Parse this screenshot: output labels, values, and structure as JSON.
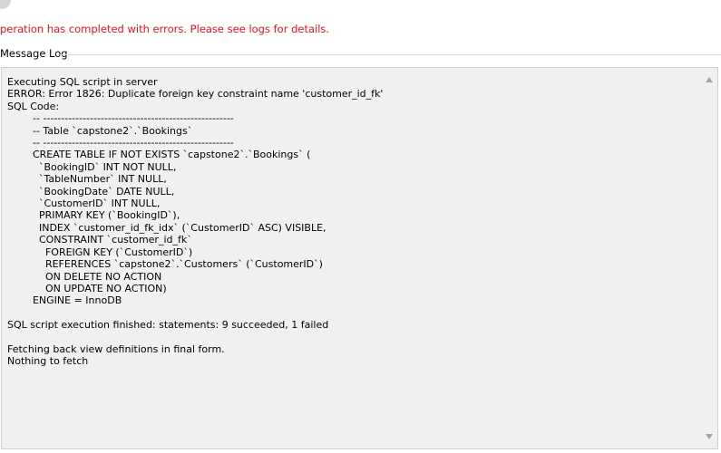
{
  "dialog": {
    "status_message": "peration has completed with errors. Please see logs for details.",
    "status_color": "#e8121e"
  },
  "message_log": {
    "group_label": "Message Log",
    "text": "Executing SQL script in server\nERROR: Error 1826: Duplicate foreign key constraint name 'customer_id_fk'\nSQL Code:\n        -- -----------------------------------------------------\n        -- Table `capstone2`.`Bookings`\n        -- -----------------------------------------------------\n        CREATE TABLE IF NOT EXISTS `capstone2`.`Bookings` (\n          `BookingID` INT NOT NULL,\n          `TableNumber` INT NULL,\n          `BookingDate` DATE NULL,\n          `CustomerID` INT NULL,\n          PRIMARY KEY (`BookingID`),\n          INDEX `customer_id_fk_idx` (`CustomerID` ASC) VISIBLE,\n          CONSTRAINT `customer_id_fk`\n            FOREIGN KEY (`CustomerID`)\n            REFERENCES `capstone2`.`Customers` (`CustomerID`)\n            ON DELETE NO ACTION\n            ON UPDATE NO ACTION)\n        ENGINE = InnoDB\n\nSQL script execution finished: statements: 9 succeeded, 1 failed\n\nFetching back view definitions in final form.\nNothing to fetch"
  },
  "icons": {
    "scroll_up": "scroll-up-arrow-icon",
    "scroll_down": "scroll-down-arrow-icon"
  }
}
